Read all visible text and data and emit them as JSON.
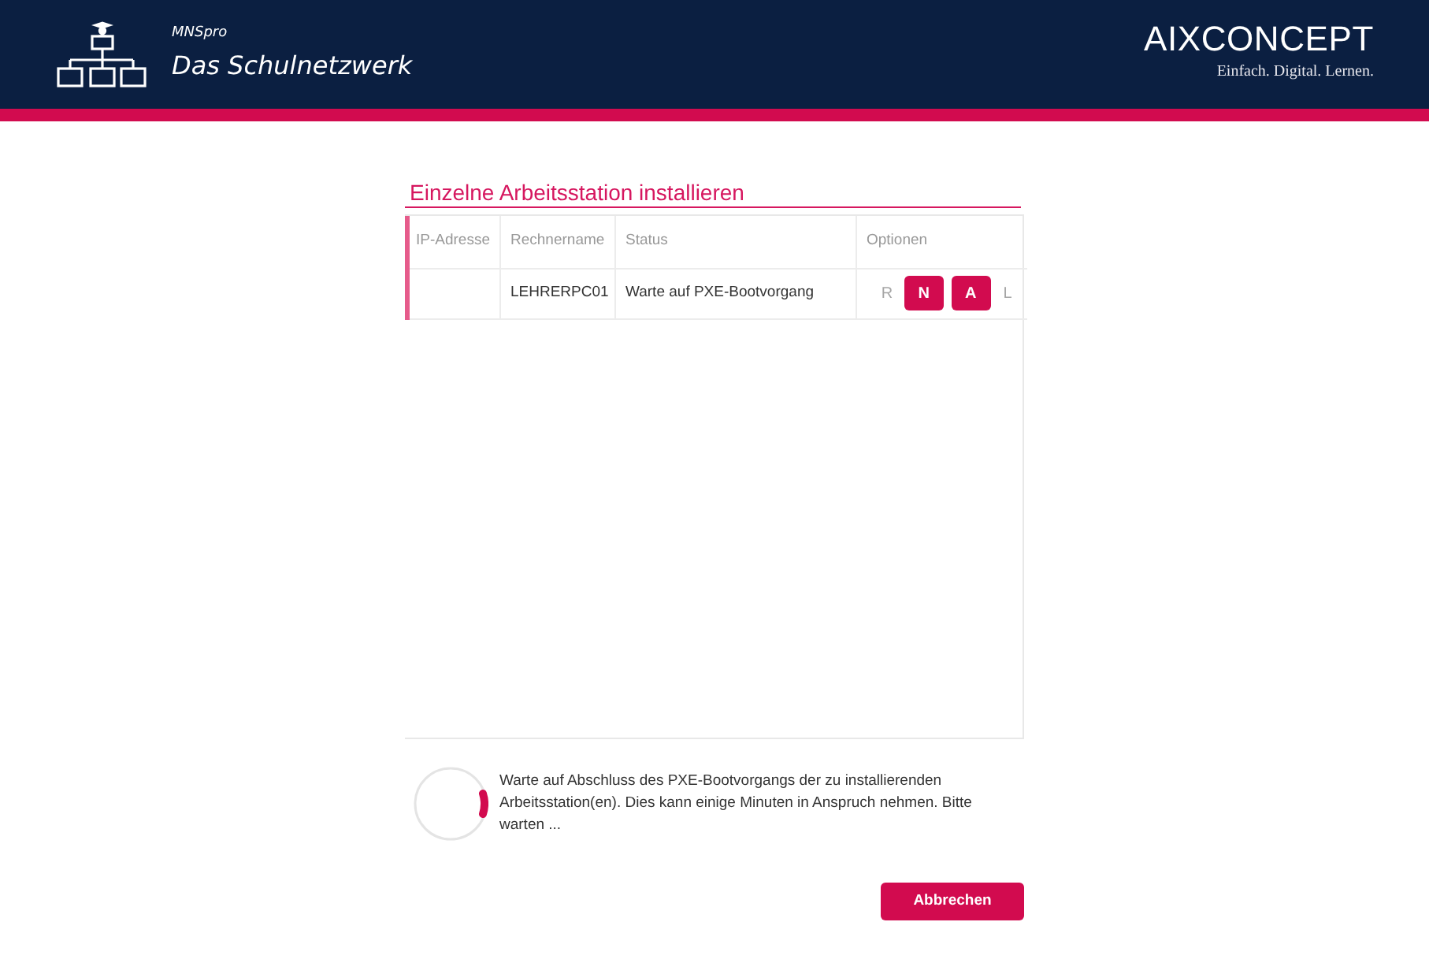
{
  "header": {
    "product": "MNSpro",
    "title": "Das Schulnetzwerk",
    "brand": "AIXCONCEPT",
    "slogan": "Einfach. Digital. Lernen."
  },
  "section": {
    "title": "Einzelne Arbeitsstation installieren"
  },
  "table": {
    "columns": [
      "IP-Adresse",
      "Rechnername",
      "Status",
      "Optionen"
    ],
    "rows": [
      {
        "rechnername": "LEHRERPC01",
        "status": "Warte auf PXE-Bootvorgang",
        "options": [
          {
            "label": "R",
            "enabled": false
          },
          {
            "label": "N",
            "enabled": true
          },
          {
            "label": "A",
            "enabled": true
          },
          {
            "label": "L",
            "enabled": false
          }
        ]
      }
    ]
  },
  "progress": {
    "message": "Warte auf Abschluss des PXE-Bootvorgangs der zu installierenden Arbeitsstation(en). Dies kann einige Minuten in Anspruch nehmen. Bitte warten ..."
  },
  "buttons": [
    {
      "label": "Abbrechen"
    }
  ]
}
